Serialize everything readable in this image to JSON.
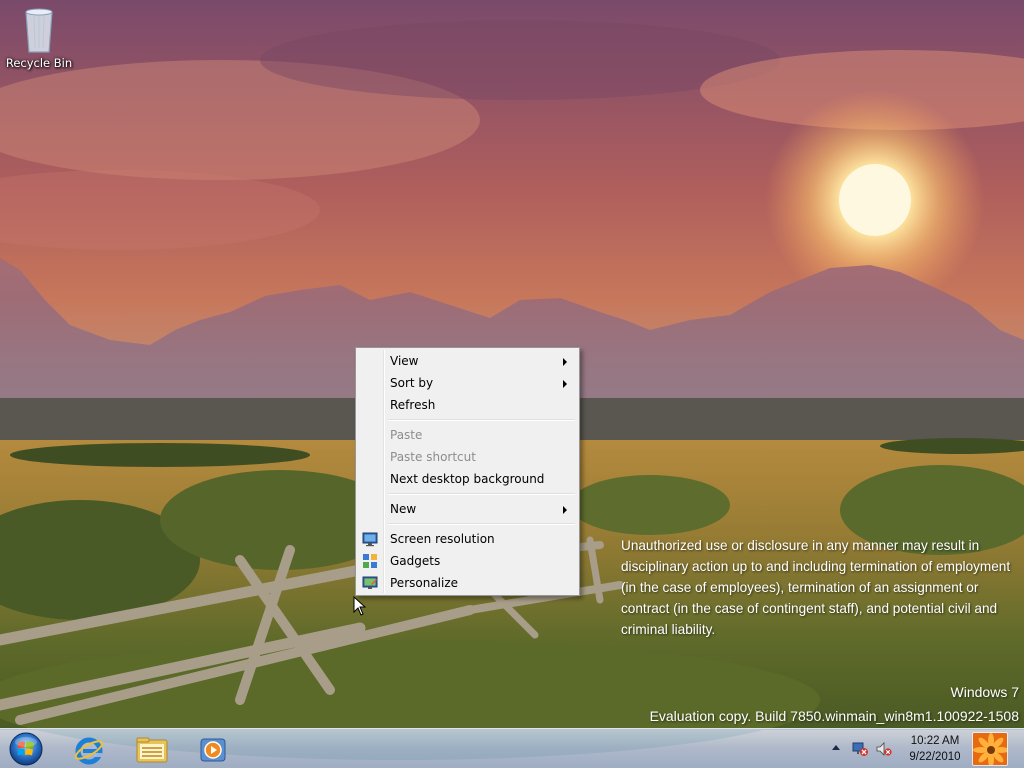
{
  "desktop": {
    "icons": [
      {
        "label": "Recycle Bin",
        "icon": "recycle-bin-icon"
      }
    ]
  },
  "context_menu": {
    "items": [
      {
        "label": "View",
        "submenu": true,
        "disabled": false
      },
      {
        "label": "Sort by",
        "submenu": true,
        "disabled": false
      },
      {
        "label": "Refresh",
        "submenu": false,
        "disabled": false
      },
      {
        "label": "Paste",
        "submenu": false,
        "disabled": true
      },
      {
        "label": "Paste shortcut",
        "submenu": false,
        "disabled": true
      },
      {
        "label": "Next desktop background",
        "submenu": false,
        "disabled": false
      },
      {
        "label": "New",
        "submenu": true,
        "disabled": false
      },
      {
        "label": "Screen resolution",
        "icon": "display-icon",
        "disabled": false
      },
      {
        "label": "Gadgets",
        "icon": "gadgets-icon",
        "disabled": false
      },
      {
        "label": "Personalize",
        "icon": "personalize-icon",
        "disabled": false
      }
    ]
  },
  "watermark": {
    "notice": "Unauthorized use or disclosure in any manner may result in disciplinary action up to and including termination of employment (in the case of employees), termination of an assignment or contract (in the case of contingent staff), and potential civil and criminal liability.",
    "os_name": "Windows 7",
    "build": "Evaluation copy. Build 7850.winmain_win8m1.100922-1508"
  },
  "taskbar": {
    "start": "start-orb-icon",
    "pinned": [
      "internet-explorer-icon",
      "windows-explorer-icon",
      "media-player-icon"
    ],
    "tray_icons": [
      "show-hidden-icons-arrow",
      "action-center-icon",
      "volume-muted-icon"
    ],
    "time": "10:22 AM",
    "date": "9/22/2010"
  },
  "colors": {
    "menu_bg": "#f0f0f0",
    "menu_disabled": "#8d8d8d",
    "taskbar": "#a5b9d7"
  }
}
